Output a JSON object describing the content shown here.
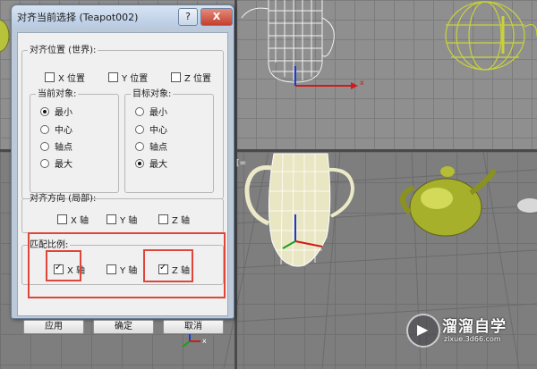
{
  "dialog": {
    "title": "对齐当前选择 (Teapot002)",
    "help_label": "?",
    "close_label": "X",
    "align_position": {
      "legend": "对齐位置 (世界):",
      "x_label": "X 位置",
      "y_label": "Y 位置",
      "z_label": "Z 位置",
      "x_checked": false,
      "y_checked": false,
      "z_checked": false
    },
    "current_object": {
      "legend": "当前对象:",
      "options": [
        "最小",
        "中心",
        "轴点",
        "最大"
      ],
      "selected": "最小"
    },
    "target_object": {
      "legend": "目标对象:",
      "options": [
        "最小",
        "中心",
        "轴点",
        "最大"
      ],
      "selected": "最大"
    },
    "align_orientation": {
      "legend": "对齐方向 (局部):",
      "x_label": "X 轴",
      "y_label": "Y 轴",
      "z_label": "Z 轴",
      "x_checked": false,
      "y_checked": false,
      "z_checked": false
    },
    "match_scale": {
      "legend": "匹配比例:",
      "x_label": "X 轴",
      "y_label": "Y 轴",
      "z_label": "Z 轴",
      "x_checked": true,
      "y_checked": false,
      "z_checked": true
    },
    "buttons": {
      "apply": "应用",
      "ok": "确定",
      "cancel": "取消"
    }
  },
  "viewport": {
    "axis_x": "x",
    "axis_z": "z",
    "bracket": "[="
  },
  "watermark": {
    "name": "溜溜自学",
    "url": "zixue.3d66.com"
  },
  "colors": {
    "highlight": "#e0453a",
    "teapot_yellow": "#b8c23a",
    "axis_red": "#d21a1a",
    "axis_green": "#19a019",
    "axis_blue": "#1a3ad2"
  }
}
